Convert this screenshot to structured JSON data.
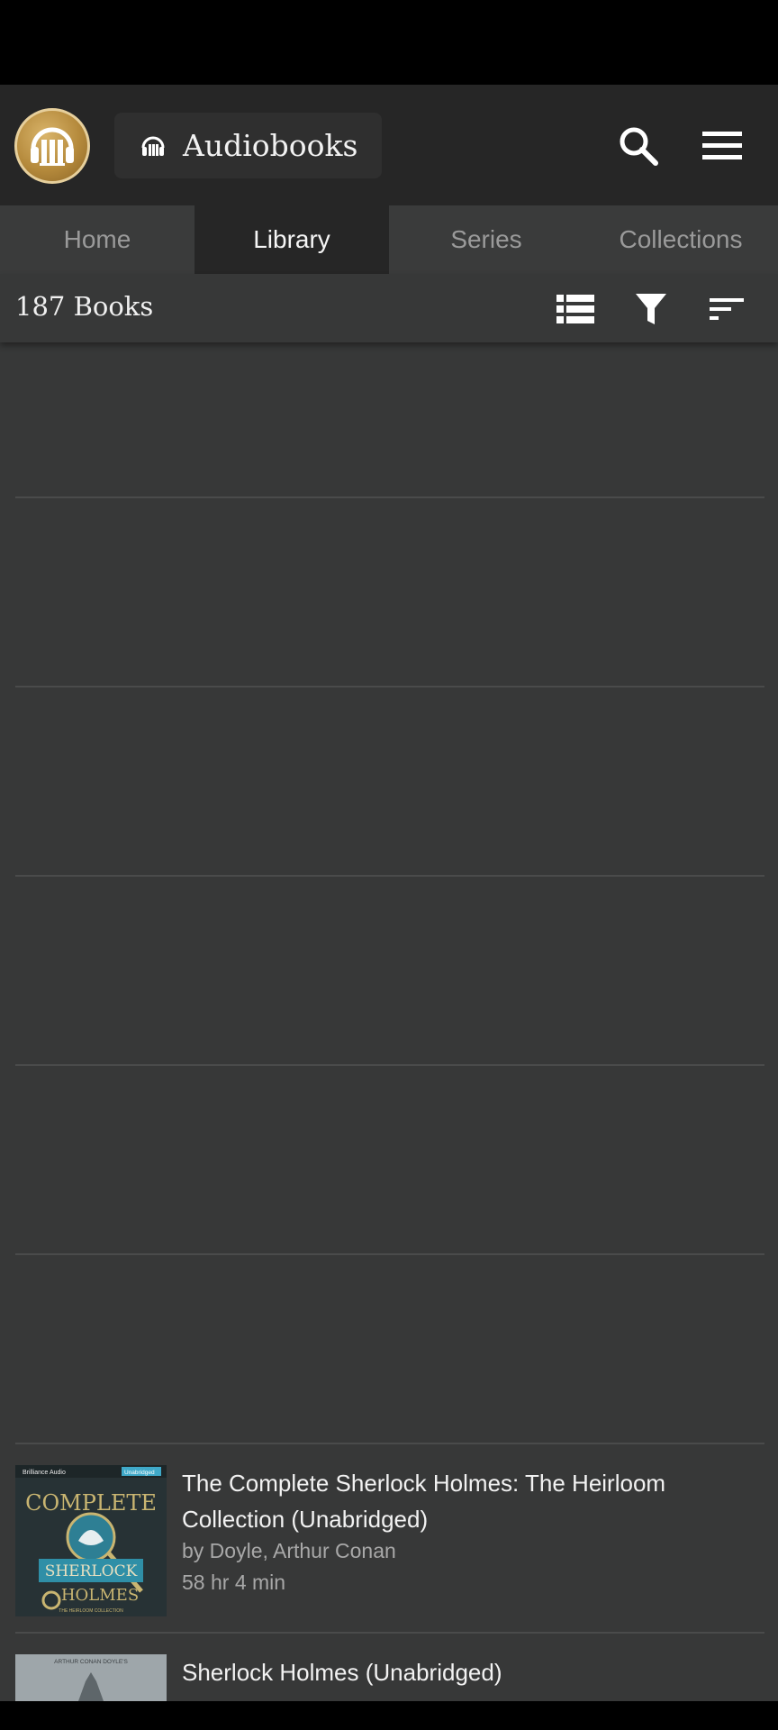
{
  "header": {
    "library_name": "Audiobooks",
    "icons": {
      "logo": "audiobookshelf-logo",
      "library": "headphones-icon",
      "search": "search-icon",
      "menu": "menu-icon"
    }
  },
  "tabs": [
    {
      "label": "Home",
      "active": false
    },
    {
      "label": "Library",
      "active": true
    },
    {
      "label": "Series",
      "active": false
    },
    {
      "label": "Collections",
      "active": false
    }
  ],
  "toolbar": {
    "count_label": "187 Books",
    "icons": [
      "list-view-icon",
      "filter-icon",
      "sort-icon"
    ]
  },
  "books": [
    {
      "title": "The Complete Sherlock Holmes: The Heirloom Collection (Unabridged)",
      "author": "by Doyle, Arthur Conan",
      "duration": "58 hr 4 min",
      "cover": {
        "publisher": "Brilliance Audio",
        "badge": "Unabridged",
        "line1": "COMPLETE",
        "line2": "SHERLOCK",
        "line3": "HOLMES",
        "tagline": "THE HEIRLOOM COLLECTION"
      }
    },
    {
      "title": "Sherlock Holmes (Unabridged)",
      "cover": {
        "text": "ARTHUR CONAN DOYLE'S"
      }
    }
  ],
  "colors": {
    "background": "#373838",
    "header": "#262626",
    "tab_bar": "#3a3b3b",
    "accent_gold": "#b58a3c"
  }
}
